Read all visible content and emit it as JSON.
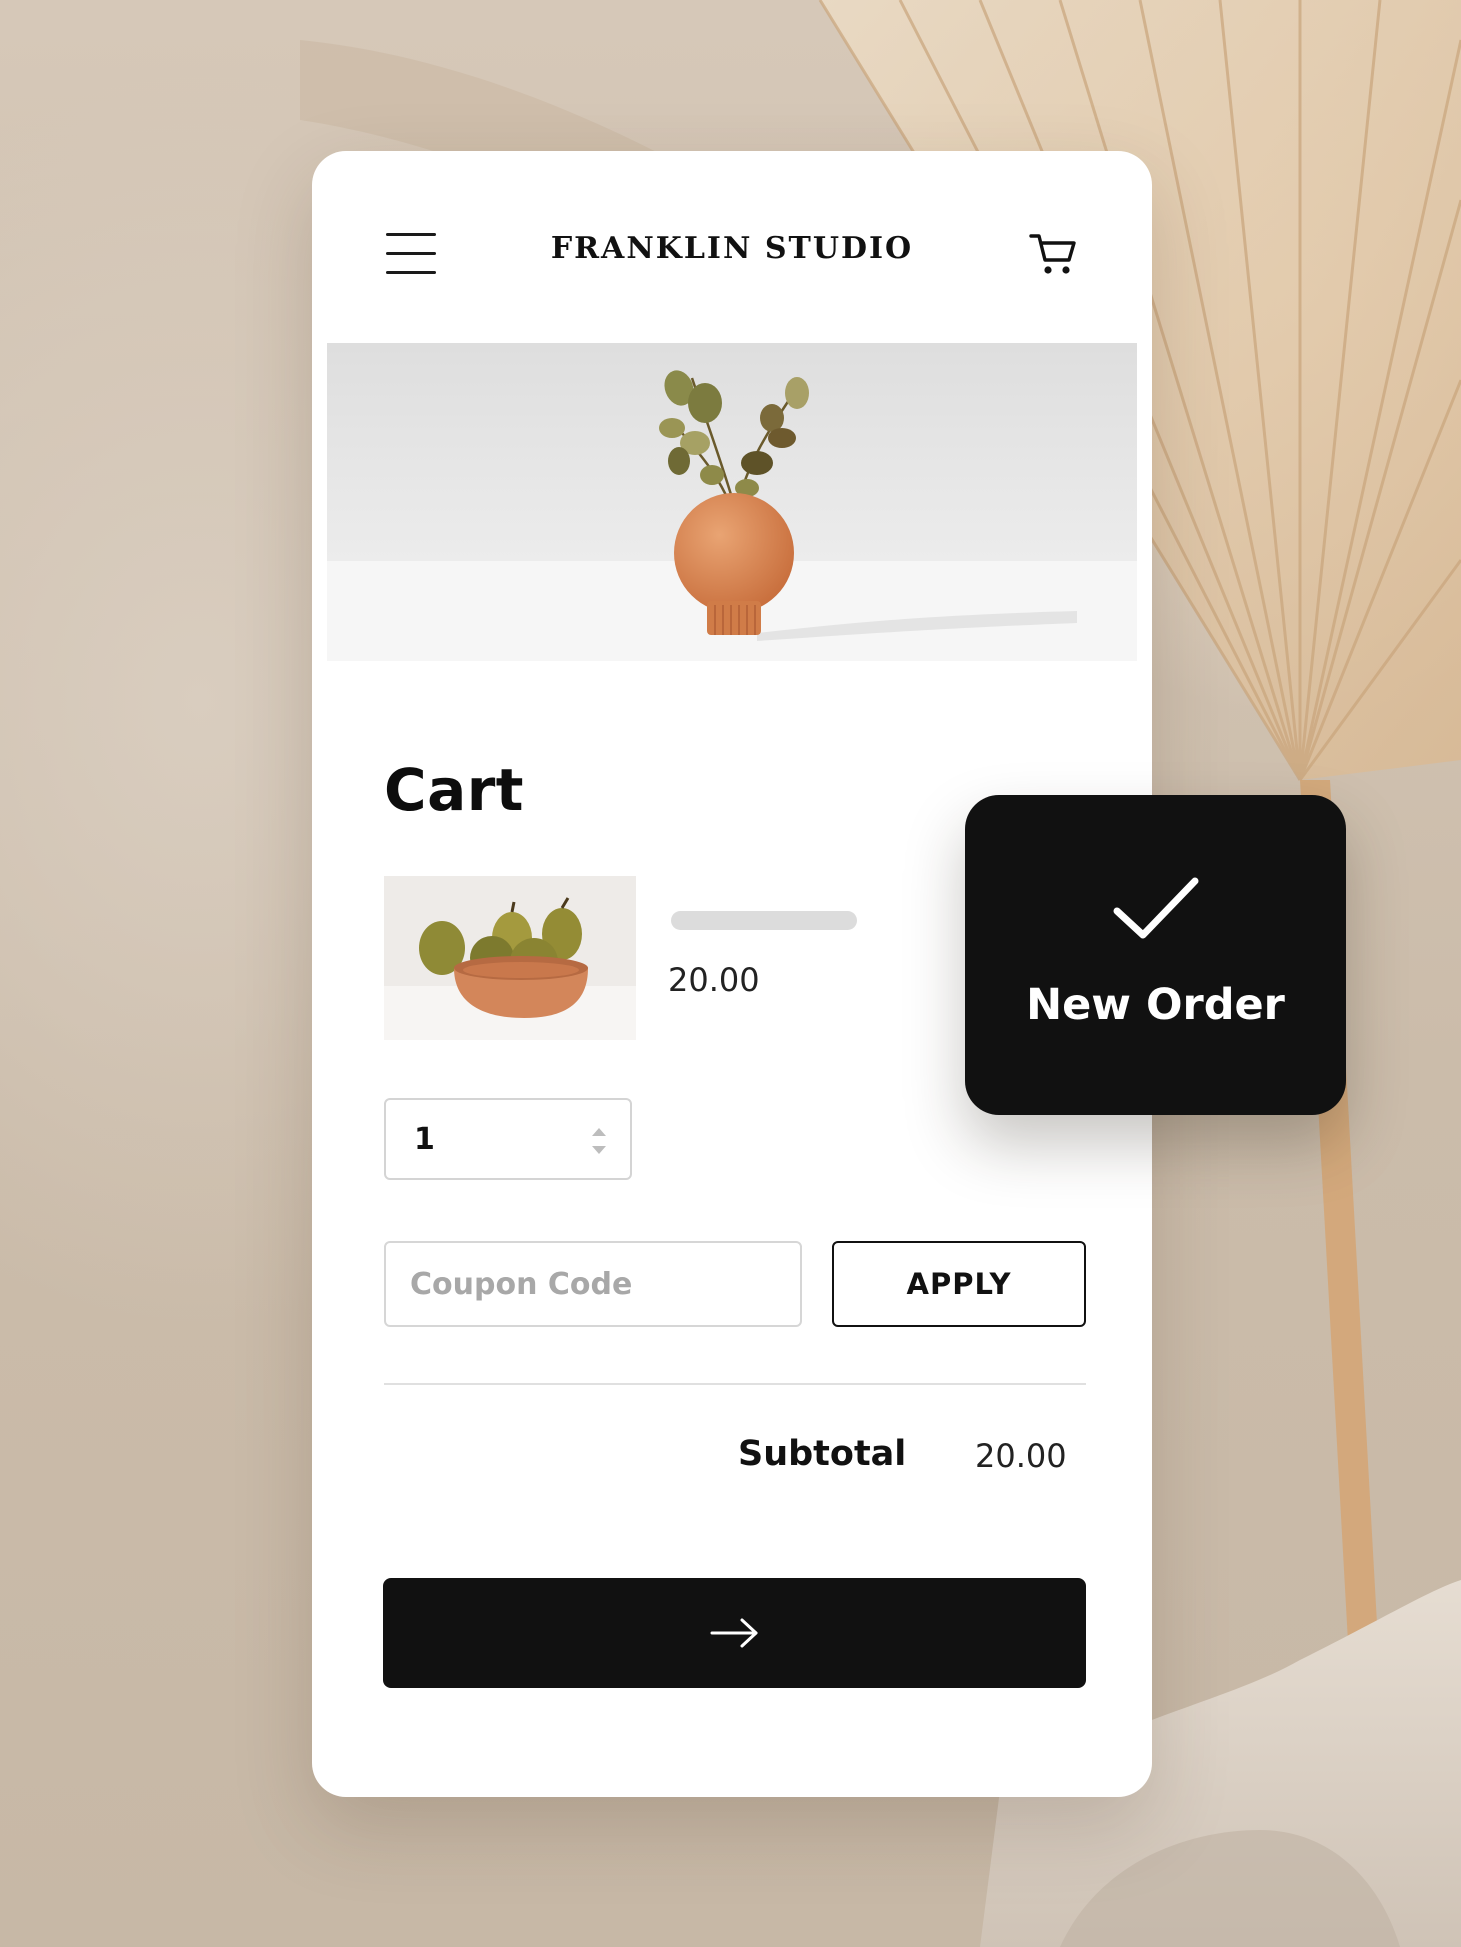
{
  "header": {
    "brand": "FRANKLIN STUDIO",
    "menu_icon": "hamburger-menu-icon",
    "cart_icon": "shopping-cart-icon"
  },
  "cart": {
    "title": "Cart",
    "item": {
      "price": "20.00",
      "quantity": "1"
    },
    "coupon": {
      "placeholder": "Coupon Code",
      "value": ""
    },
    "apply_label": "APPLY",
    "subtotal_label": "Subtotal",
    "subtotal_value": "20.00",
    "checkout_icon": "arrow-right-icon"
  },
  "toast": {
    "label": "New Order",
    "icon": "checkmark-icon"
  },
  "colors": {
    "accent_dark": "#111111",
    "card_background": "#ffffff",
    "placeholder_bar": "#dcdcdc",
    "backdrop": "#cdbfb0"
  }
}
